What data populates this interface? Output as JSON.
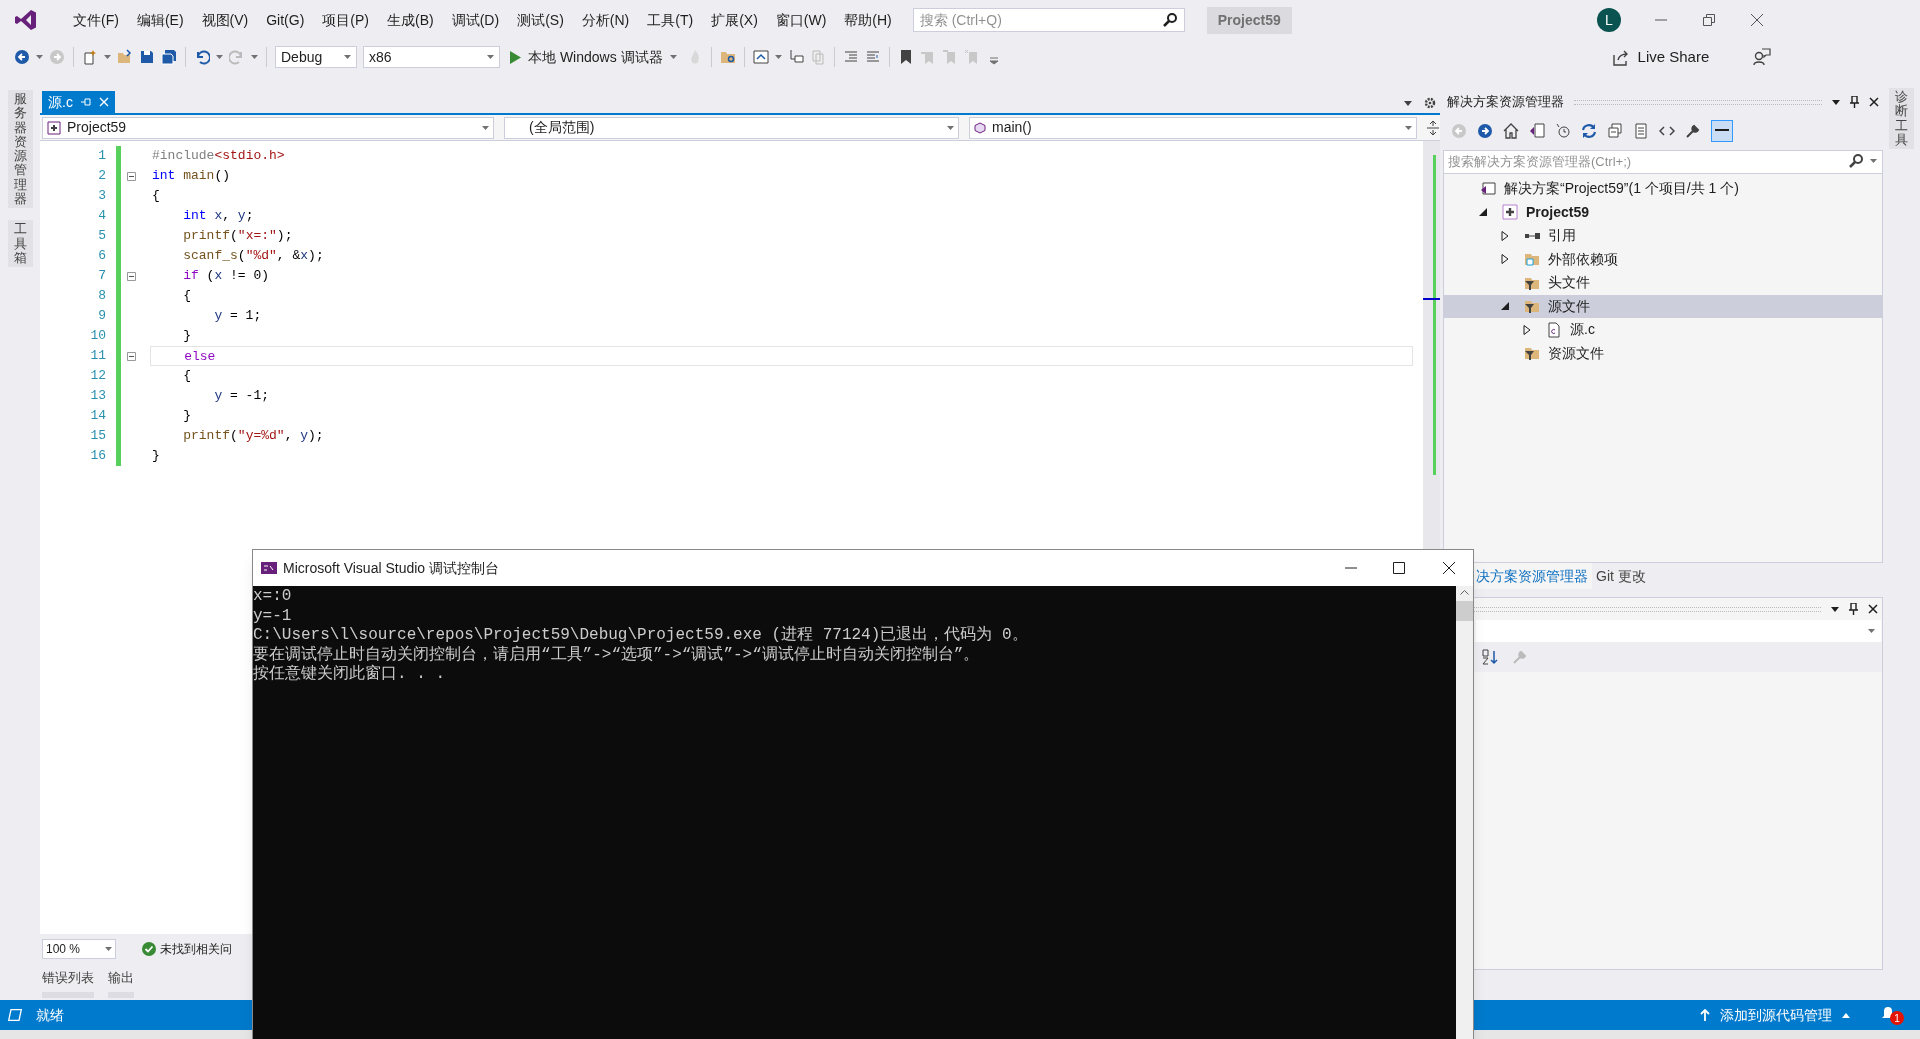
{
  "title_bar": {
    "menu": [
      "文件(F)",
      "编辑(E)",
      "视图(V)",
      "Git(G)",
      "项目(P)",
      "生成(B)",
      "调试(D)",
      "测试(S)",
      "分析(N)",
      "工具(T)",
      "扩展(X)",
      "窗口(W)",
      "帮助(H)"
    ],
    "search": {
      "placeholder": "搜索 (Ctrl+Q)"
    },
    "solution_name": "Project59",
    "avatar": "L"
  },
  "toolbar": {
    "configuration": "Debug",
    "platform": "x86",
    "run_label": "本地 Windows 调试器",
    "live_share": "Live Share"
  },
  "side_tabs_left": [
    "服务器资源管理器",
    "工具箱"
  ],
  "side_tabs_right": [
    "诊断工具"
  ],
  "document_tabs": [
    {
      "label": "源.c",
      "selected": true
    }
  ],
  "nav_bar": {
    "project": "Project59",
    "scope": "(全局范围)",
    "member": "main()"
  },
  "code_lines": [
    {
      "number": "1",
      "foldable": false,
      "current": false,
      "tokens": [
        {
          "kind": "pre",
          "text": "#include"
        },
        {
          "kind": "inc",
          "text": "<stdio.h>"
        }
      ]
    },
    {
      "number": "2",
      "foldable": true,
      "current": false,
      "tokens": [
        {
          "kind": "kw",
          "text": "int"
        },
        {
          "kind": "fn",
          "text": " main"
        },
        {
          "kind": "p",
          "text": "()"
        }
      ]
    },
    {
      "number": "3",
      "foldable": false,
      "current": false,
      "tokens": [
        {
          "kind": "p",
          "text": "{"
        }
      ]
    },
    {
      "number": "4",
      "foldable": false,
      "current": false,
      "tokens": [
        {
          "kind": "kw",
          "text": "    int"
        },
        {
          "kind": "var",
          "text": " x"
        },
        {
          "kind": "p",
          "text": ", "
        },
        {
          "kind": "var",
          "text": "y"
        },
        {
          "kind": "p",
          "text": ";"
        }
      ]
    },
    {
      "number": "5",
      "foldable": false,
      "current": false,
      "tokens": [
        {
          "kind": "fn",
          "text": "    printf"
        },
        {
          "kind": "p",
          "text": "("
        },
        {
          "kind": "str",
          "text": "\"x=:\""
        },
        {
          "kind": "p",
          "text": ");"
        }
      ]
    },
    {
      "number": "6",
      "foldable": false,
      "current": false,
      "tokens": [
        {
          "kind": "fn",
          "text": "    scanf_s"
        },
        {
          "kind": "p",
          "text": "("
        },
        {
          "kind": "str",
          "text": "\"%d\""
        },
        {
          "kind": "p",
          "text": ", &"
        },
        {
          "kind": "var",
          "text": "x"
        },
        {
          "kind": "p",
          "text": ");"
        }
      ]
    },
    {
      "number": "7",
      "foldable": true,
      "current": false,
      "tokens": [
        {
          "kind": "ctl",
          "text": "    if"
        },
        {
          "kind": "p",
          "text": " ("
        },
        {
          "kind": "var",
          "text": "x"
        },
        {
          "kind": "p",
          "text": " != 0)"
        }
      ]
    },
    {
      "number": "8",
      "foldable": false,
      "current": false,
      "tokens": [
        {
          "kind": "p",
          "text": "    {"
        }
      ]
    },
    {
      "number": "9",
      "foldable": false,
      "current": false,
      "tokens": [
        {
          "kind": "var",
          "text": "        y"
        },
        {
          "kind": "p",
          "text": " = 1;"
        }
      ]
    },
    {
      "number": "10",
      "foldable": false,
      "current": false,
      "tokens": [
        {
          "kind": "p",
          "text": "    }"
        }
      ]
    },
    {
      "number": "11",
      "foldable": true,
      "current": true,
      "tokens": [
        {
          "kind": "ctl",
          "text": "    else"
        }
      ]
    },
    {
      "number": "12",
      "foldable": false,
      "current": false,
      "tokens": [
        {
          "kind": "p",
          "text": "    {"
        }
      ]
    },
    {
      "number": "13",
      "foldable": false,
      "current": false,
      "tokens": [
        {
          "kind": "var",
          "text": "        y"
        },
        {
          "kind": "p",
          "text": " = -1;"
        }
      ]
    },
    {
      "number": "14",
      "foldable": false,
      "current": false,
      "tokens": [
        {
          "kind": "p",
          "text": "    }"
        }
      ]
    },
    {
      "number": "15",
      "foldable": false,
      "current": false,
      "tokens": [
        {
          "kind": "fn",
          "text": "    printf"
        },
        {
          "kind": "p",
          "text": "("
        },
        {
          "kind": "str",
          "text": "\"y=%d\""
        },
        {
          "kind": "p",
          "text": ", "
        },
        {
          "kind": "var",
          "text": "y"
        },
        {
          "kind": "p",
          "text": ");"
        }
      ]
    },
    {
      "number": "16",
      "foldable": false,
      "current": false,
      "tokens": [
        {
          "kind": "p",
          "text": "}"
        }
      ]
    }
  ],
  "editor_footer": {
    "zoom": "100 %",
    "status": "未找到相关问"
  },
  "bottom_tabs": [
    "错误列表",
    "输出"
  ],
  "solution_explorer": {
    "title": "解决方案资源管理器",
    "search": {
      "placeholder": "搜索解决方案资源管理器(Ctrl+;)"
    },
    "tree": [
      {
        "label": "解决方案“Project59”(1 个项目/共 1 个)",
        "kind": "solution",
        "selected": false,
        "children": [
          {
            "label": "Project59",
            "kind": "project",
            "expanded": true,
            "selected": false,
            "children": [
              {
                "label": "引用",
                "kind": "references",
                "expanded": false,
                "selected": false
              },
              {
                "label": "外部依赖项",
                "kind": "external",
                "expanded": false,
                "selected": false
              },
              {
                "label": "头文件",
                "kind": "filter",
                "selected": false
              },
              {
                "label": "源文件",
                "kind": "filter",
                "expanded": true,
                "selected": true,
                "children": [
                  {
                    "label": "源.c",
                    "kind": "file",
                    "expanded": false,
                    "selected": false
                  }
                ]
              },
              {
                "label": "资源文件",
                "kind": "filter",
                "selected": false
              }
            ]
          }
        ]
      }
    ]
  },
  "panel_tabs": [
    {
      "label": "决方案资源管理器",
      "selected": true
    },
    {
      "label": "Git 更改",
      "selected": false
    }
  ],
  "status_bar": {
    "text": "就绪",
    "source_control": "添加到源代码管理",
    "notifications": "1"
  },
  "console": {
    "title": "Microsoft Visual Studio 调试控制台",
    "lines": [
      "x=:0",
      "y=-1",
      "C:\\Users\\l\\source\\repos\\Project59\\Debug\\Project59.exe (进程 77124)已退出，代码为 0。",
      "要在调试停止时自动关闭控制台，请启用“工具”->“选项”->“调试”->“调试停止时自动关闭控制台”。",
      "按任意键关闭此窗口. . ."
    ]
  }
}
